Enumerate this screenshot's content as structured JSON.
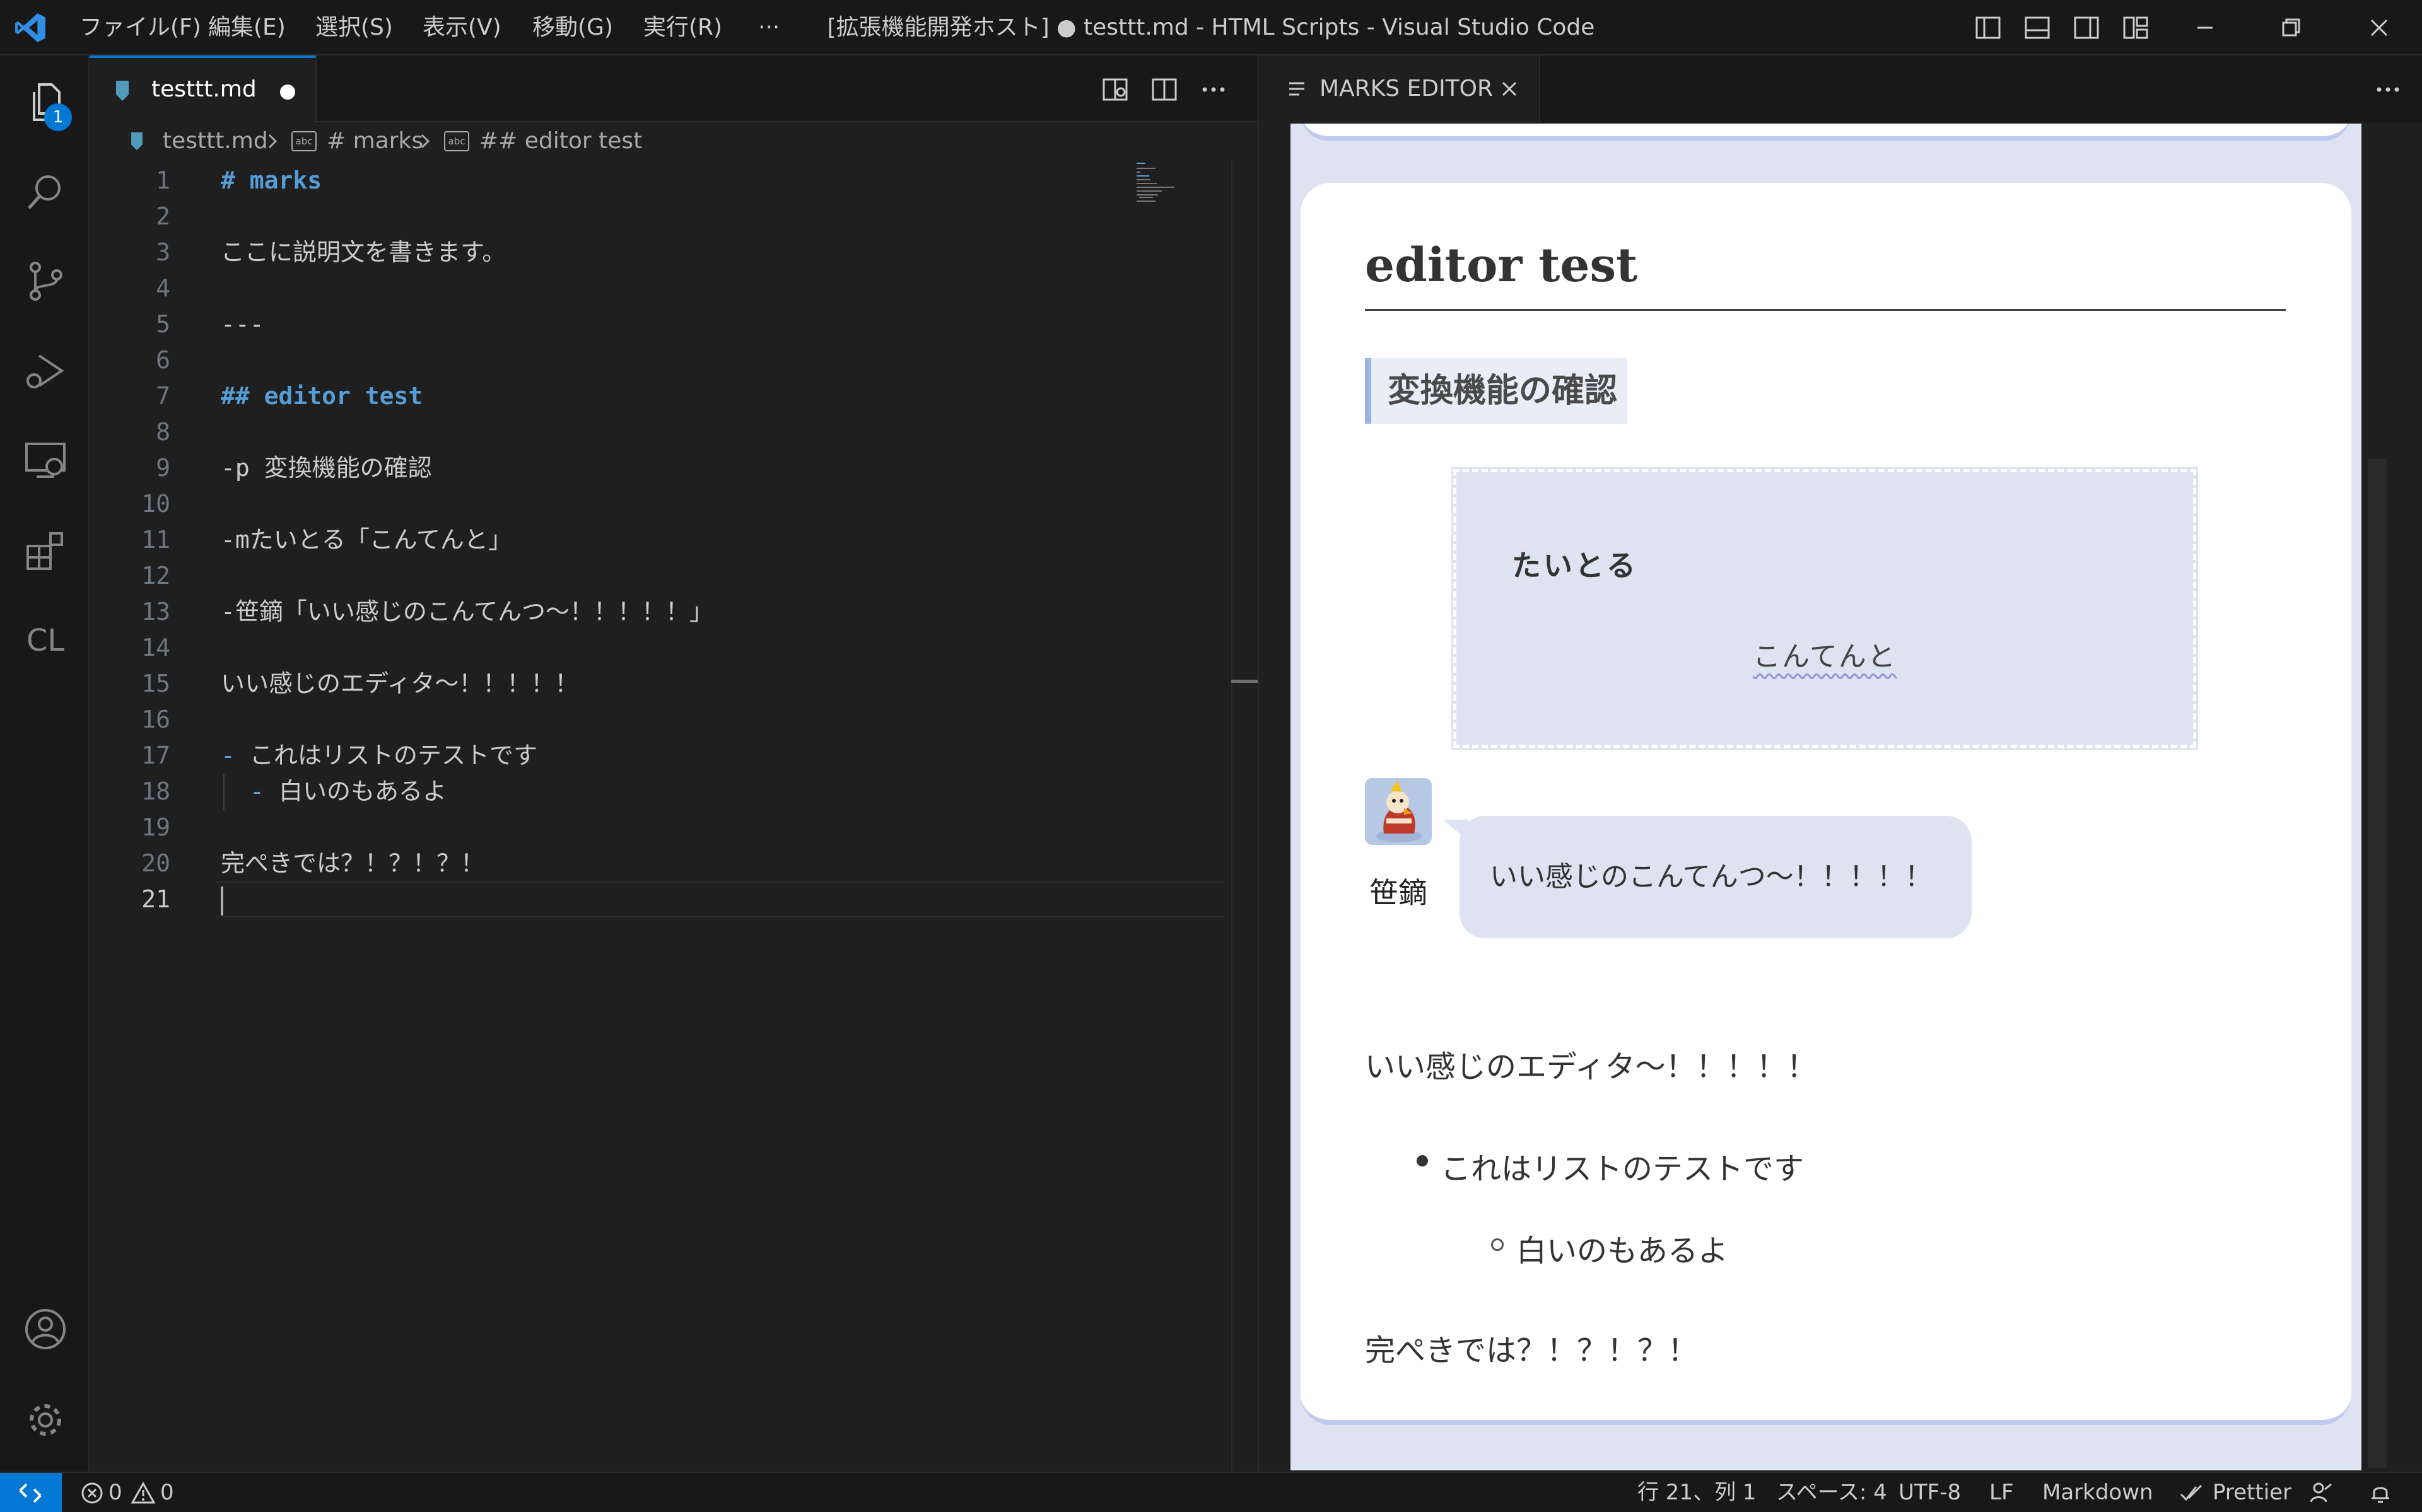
{
  "titlebar": {
    "menus": [
      "ファイル(F)",
      "編集(E)",
      "選択(S)",
      "表示(V)",
      "移動(G)",
      "実行(R)",
      "···"
    ],
    "title": "[拡張機能開発ホスト] ● testtt.md - HTML Scripts - Visual Studio Code"
  },
  "activitybar": {
    "explorer_badge": "1",
    "cl_label": "CL",
    "icons": [
      "files-icon",
      "search-icon",
      "source-control-icon",
      "run-debug-icon",
      "remote-explorer-icon",
      "extensions-icon",
      "account-icon",
      "settings-gear-icon"
    ]
  },
  "editor": {
    "tab_label": "testtt.md",
    "breadcrumb": {
      "file": "testtt.md",
      "symbol1": "# marks",
      "symbol2": "## editor test",
      "symbol_icon_text": "abc"
    },
    "lines": [
      {
        "n": "1",
        "text": "# marks",
        "kind": "heading"
      },
      {
        "n": "2",
        "text": "",
        "kind": "plain"
      },
      {
        "n": "3",
        "text": "ここに説明文を書きます。",
        "kind": "plain"
      },
      {
        "n": "4",
        "text": "",
        "kind": "plain"
      },
      {
        "n": "5",
        "text": "---",
        "kind": "plain"
      },
      {
        "n": "6",
        "text": "",
        "kind": "plain"
      },
      {
        "n": "7",
        "text": "## editor test",
        "kind": "heading"
      },
      {
        "n": "8",
        "text": "",
        "kind": "plain"
      },
      {
        "n": "9",
        "text": "-p 変換機能の確認",
        "kind": "plain"
      },
      {
        "n": "10",
        "text": "",
        "kind": "plain"
      },
      {
        "n": "11",
        "text": "-mたいとる「こんてんと」",
        "kind": "plain"
      },
      {
        "n": "12",
        "text": "",
        "kind": "plain"
      },
      {
        "n": "13",
        "text": "-笹鏑「いい感じのこんてんつ～！！！！！」",
        "kind": "plain"
      },
      {
        "n": "14",
        "text": "",
        "kind": "plain"
      },
      {
        "n": "15",
        "text": "いい感じのエディタ～！！！！！",
        "kind": "plain"
      },
      {
        "n": "16",
        "text": "",
        "kind": "plain"
      },
      {
        "n": "17",
        "bullet": "-",
        "text": "これはリストのテストです",
        "kind": "list"
      },
      {
        "n": "18",
        "bullet": "-",
        "text": "白いのもあるよ",
        "kind": "list2"
      },
      {
        "n": "19",
        "text": "",
        "kind": "plain"
      },
      {
        "n": "20",
        "text": "完ぺきでは？！？！？！",
        "kind": "plain"
      },
      {
        "n": "21",
        "text": "",
        "kind": "current"
      }
    ]
  },
  "right_panel": {
    "tab_label": "MARKS EDITOR",
    "preview": {
      "heading": "editor test",
      "paragraph_label": "変換機能の確認",
      "box_title": "たいとる",
      "box_body": "こんてんと",
      "speaker_name": "笹鏑",
      "speech": "いい感じのこんてんつ～！！！！！",
      "text1": "いい感じのエディタ～！！！！！",
      "list_item1": "これはリストのテストです",
      "list_item2": "白いのもあるよ",
      "text2": "完ぺきでは？！？！？！"
    }
  },
  "statusbar": {
    "errors": "0",
    "warnings": "0",
    "position": "行 21、列 1",
    "spaces": "スペース: 4",
    "encoding": "UTF-8",
    "eol": "LF",
    "language": "Markdown",
    "prettier": "Prettier"
  },
  "colors": {
    "accent": "#0078d4",
    "heading": "#569cd6",
    "preview_bg": "#dde3f1",
    "preview_border": "#bfcaee"
  }
}
